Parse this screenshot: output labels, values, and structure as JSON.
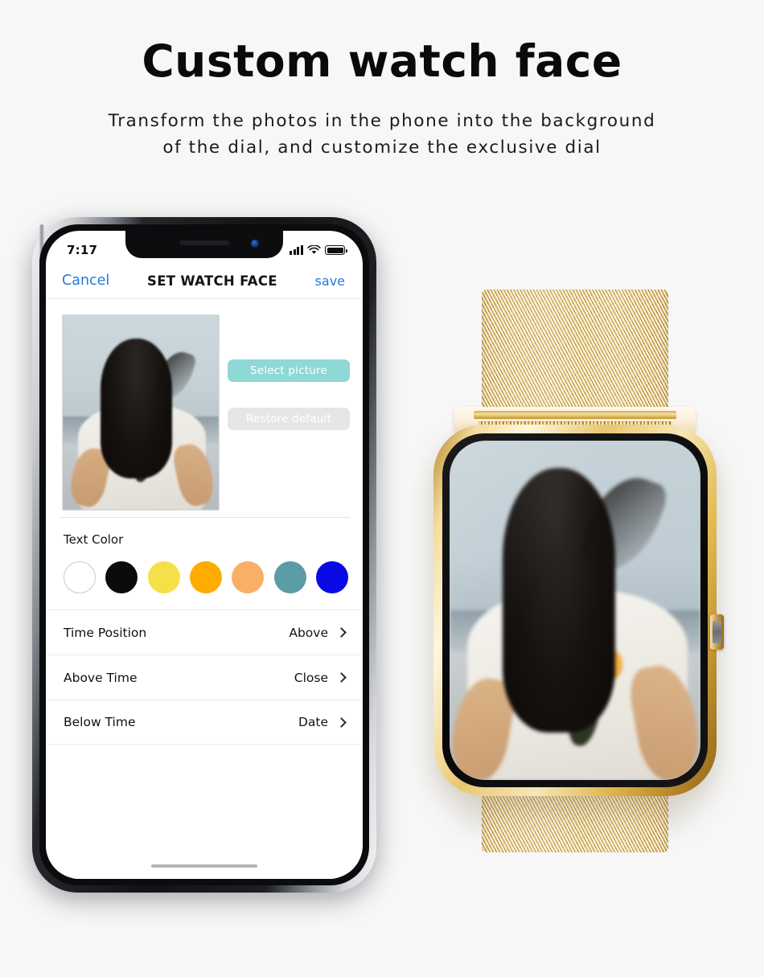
{
  "hero": {
    "title": "Custom watch face",
    "subtitle_line1": "Transform the photos in the phone into the background",
    "subtitle_line2": "of the dial, and customize the exclusive dial"
  },
  "phone": {
    "status_bar": {
      "time": "7:17",
      "signal_icon": "cellular-bars-icon",
      "wifi_icon": "wifi-icon",
      "battery_icon": "battery-full-icon"
    },
    "nav_bar": {
      "cancel_label": "Cancel",
      "title": "SET WATCH FACE",
      "save_label": "save",
      "link_color": "#2878d8"
    },
    "preview": {
      "photo_alt": "woman-with-long-dark-hair-holding-yellow-flower"
    },
    "actions": [
      {
        "label": "Select picture",
        "bg": "#8ed8d6",
        "fg": "#ffffff"
      },
      {
        "label": "Restore default",
        "bg": "#e6e6e6",
        "fg": "#ffffff"
      }
    ],
    "text_color": {
      "label": "Text Color",
      "swatches": [
        {
          "name": "white",
          "hex": "#ffffff",
          "ring": true
        },
        {
          "name": "black",
          "hex": "#0b0b0b",
          "ring": false
        },
        {
          "name": "yellow",
          "hex": "#f5e04a",
          "ring": false
        },
        {
          "name": "orange",
          "hex": "#ffab00",
          "ring": false
        },
        {
          "name": "peach",
          "hex": "#f8b069",
          "ring": false
        },
        {
          "name": "teal",
          "hex": "#5a9da4",
          "ring": false
        },
        {
          "name": "blue",
          "hex": "#0a0ae6",
          "ring": false
        }
      ]
    },
    "settings_rows": [
      {
        "label": "Time Position",
        "value": "Above"
      },
      {
        "label": "Above Time",
        "value": "Close"
      },
      {
        "label": "Below Time",
        "value": "Date"
      }
    ]
  },
  "watch": {
    "band_material": "gold-milanese-mesh",
    "case_color": "#e8c671",
    "crown_icon": "side-crown-button",
    "face_alt": "woman-with-long-dark-hair-holding-yellow-flower"
  },
  "theme": {
    "page_bg": "#f7f7f7",
    "text_primary": "#0a0a0a"
  }
}
